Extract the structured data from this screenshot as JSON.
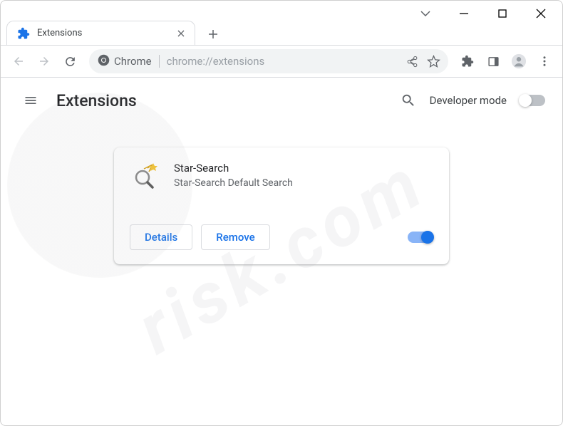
{
  "window": {
    "tab": {
      "title": "Extensions"
    }
  },
  "omnibox": {
    "label": "Chrome",
    "url": "chrome://extensions"
  },
  "page": {
    "title": "Extensions",
    "dev_mode_label": "Developer mode"
  },
  "extension": {
    "name": "Star-Search",
    "description": "Star-Search Default Search",
    "details_label": "Details",
    "remove_label": "Remove",
    "enabled": true
  },
  "watermark": "risk.com"
}
